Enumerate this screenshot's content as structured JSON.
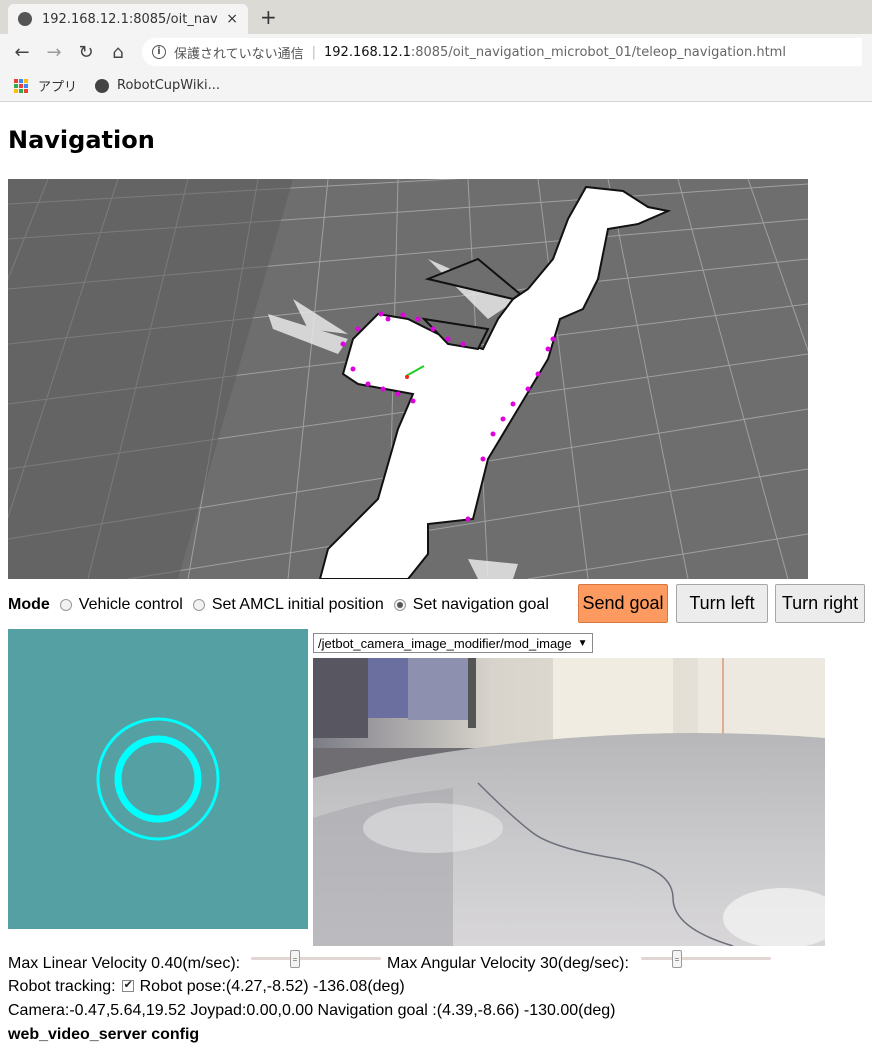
{
  "browser": {
    "tab_title": "192.168.12.1:8085/oit_nav",
    "tab_close": "×",
    "new_tab": "+",
    "back": "←",
    "forward": "→",
    "reload": "↻",
    "home": "⌂",
    "security_text": "保護されていない通信",
    "url_host": "192.168.12.1",
    "url_path": ":8085/oit_navigation_microbot_01/teleop_navigation.html",
    "bookmarks": [
      {
        "label": "アプリ",
        "icon": "apps-grid-icon"
      },
      {
        "label": "RobotCupWiki...",
        "icon": "globe-icon"
      }
    ]
  },
  "page": {
    "title": "Navigation"
  },
  "mode": {
    "label": "Mode",
    "options": [
      {
        "label": "Vehicle control",
        "checked": false
      },
      {
        "label": "Set AMCL initial position",
        "checked": false
      },
      {
        "label": "Set navigation goal",
        "checked": true
      }
    ]
  },
  "buttons": {
    "send_goal": "Send goal",
    "turn_left": "Turn left",
    "turn_right": "Turn right",
    "send_goal_color": "#fc9a5f"
  },
  "camera": {
    "topic": "/jetbot_camera_image_modifier/mod_image"
  },
  "velocity": {
    "linear_label": "Max Linear Velocity 0.40(m/sec):",
    "angular_label": "Max Angular Velocity 30(deg/sec):",
    "linear_value": 0.4,
    "angular_value": 30
  },
  "status": {
    "tracking_label": "Robot tracking:",
    "tracking_checked": true,
    "robot_pose": "Robot pose:(4.27,-8.52) -136.08(deg)",
    "camera_line": "Camera:-0.47,5.64,19.52 Joypad:0.00,0.00 Navigation goal :(4.39,-8.66) -130.00(deg)",
    "config_title": "web_video_server config"
  },
  "colors": {
    "joypad_bg": "#55a0a2",
    "joypad_ring": "#00ffff",
    "map_floor": "#6e6e6e",
    "laser_points": "#e000e0"
  }
}
